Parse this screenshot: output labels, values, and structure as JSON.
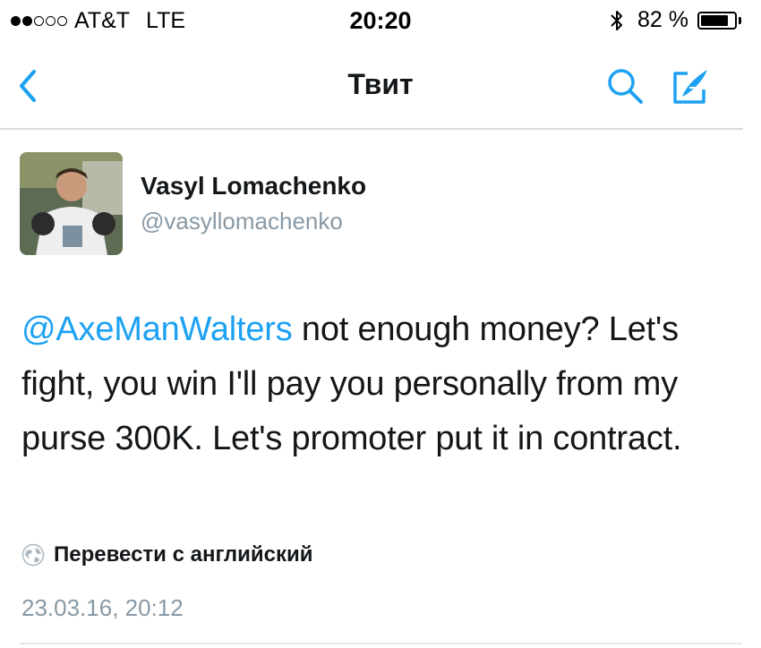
{
  "status_bar": {
    "signal_bars_filled": 2,
    "signal_bars_total": 5,
    "carrier": "AT&T",
    "network": "LTE",
    "time": "20:20",
    "battery_percent_label": "82 %",
    "battery_level": 0.82
  },
  "nav": {
    "title": "Твит",
    "back_icon": "chevron-left-icon",
    "search_icon": "search-icon",
    "compose_icon": "compose-icon"
  },
  "tweet": {
    "author_name": "Vasyl Lomachenko",
    "author_handle": "@vasyllomachenko",
    "mention": "@AxeManWalters",
    "text": " not enough money? Let's fight, you win I'll pay you personally from my purse 300K. Let's promoter put it in contract.",
    "translate_label": "Перевести с английский",
    "timestamp": "23.03.16, 20:12"
  },
  "colors": {
    "accent": "#1da1f2",
    "secondary_text": "#8899a6",
    "divider": "#d6dbe0"
  }
}
